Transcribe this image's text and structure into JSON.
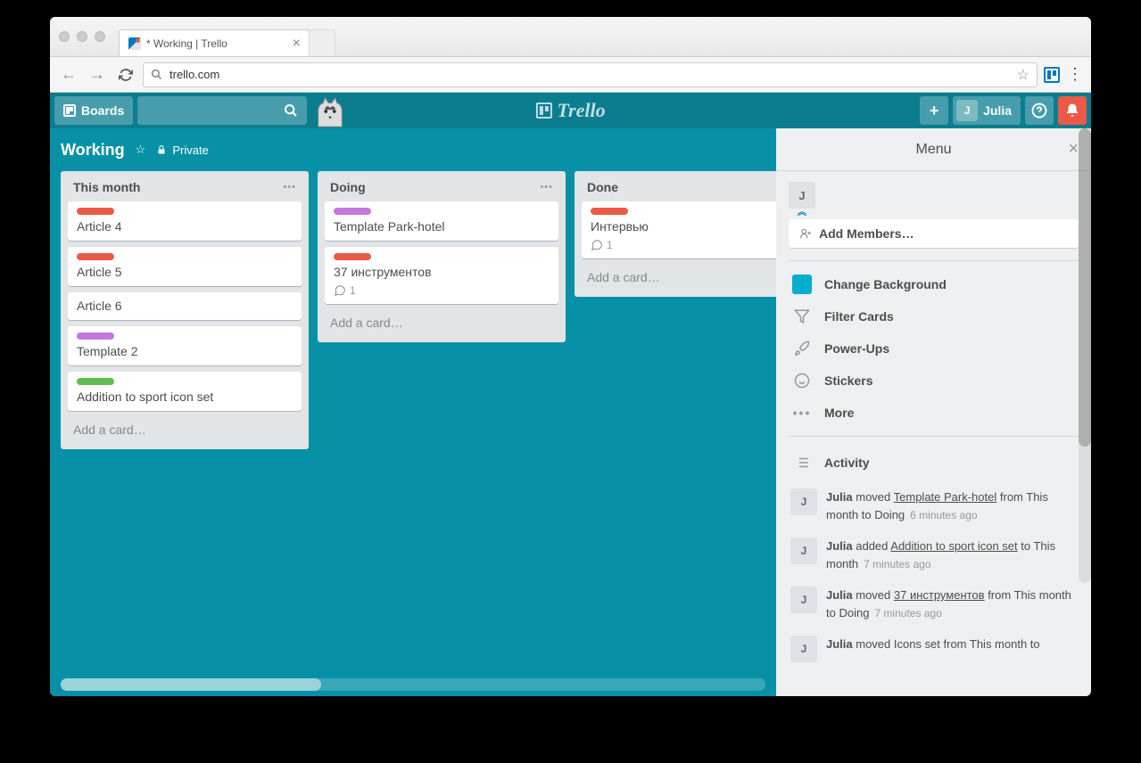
{
  "browser": {
    "tab_title": "* Working | Trello",
    "url": "trello.com"
  },
  "topbar": {
    "boards_label": "Boards",
    "user_initial": "J",
    "user_name": "Julia"
  },
  "board": {
    "name": "Working",
    "privacy": "Private"
  },
  "lists": [
    {
      "title": "This month",
      "cards": [
        {
          "label": "red",
          "title": "Article 4"
        },
        {
          "label": "red",
          "title": "Article 5"
        },
        {
          "label": null,
          "title": "Article 6"
        },
        {
          "label": "purple",
          "title": "Template 2"
        },
        {
          "label": "green",
          "title": "Addition to sport icon set"
        }
      ],
      "add_label": "Add a card…"
    },
    {
      "title": "Doing",
      "cards": [
        {
          "label": "purple",
          "title": "Template Park-hotel"
        },
        {
          "label": "red",
          "title": "37 инструментов",
          "comments": "1"
        }
      ],
      "add_label": "Add a card…"
    },
    {
      "title": "Done",
      "cards": [
        {
          "label": "red",
          "title": "Интервью",
          "comments": "1"
        }
      ],
      "add_label": "Add a card…"
    }
  ],
  "menu": {
    "title": "Menu",
    "member_initial": "J",
    "add_members": "Add Members…",
    "items": {
      "change_bg": "Change Background",
      "filter": "Filter Cards",
      "powerups": "Power-Ups",
      "stickers": "Stickers",
      "more": "More"
    },
    "activity_label": "Activity",
    "activity": [
      {
        "initial": "J",
        "user": "Julia",
        "action_pre": " moved ",
        "link": "Template Park-hotel",
        "action_post": " from This month to Doing",
        "time": "6 minutes ago"
      },
      {
        "initial": "J",
        "user": "Julia",
        "action_pre": " added ",
        "link": "Addition to sport icon set",
        "action_post": " to This month",
        "time": "7 minutes ago"
      },
      {
        "initial": "J",
        "user": "Julia",
        "action_pre": " moved ",
        "link": "37 инструментов",
        "action_post": " from This month to Doing",
        "time": "7 minutes ago"
      },
      {
        "initial": "J",
        "user": "Julia",
        "action_pre": " moved Icons set from This month to",
        "link": "",
        "action_post": "",
        "time": ""
      }
    ]
  }
}
